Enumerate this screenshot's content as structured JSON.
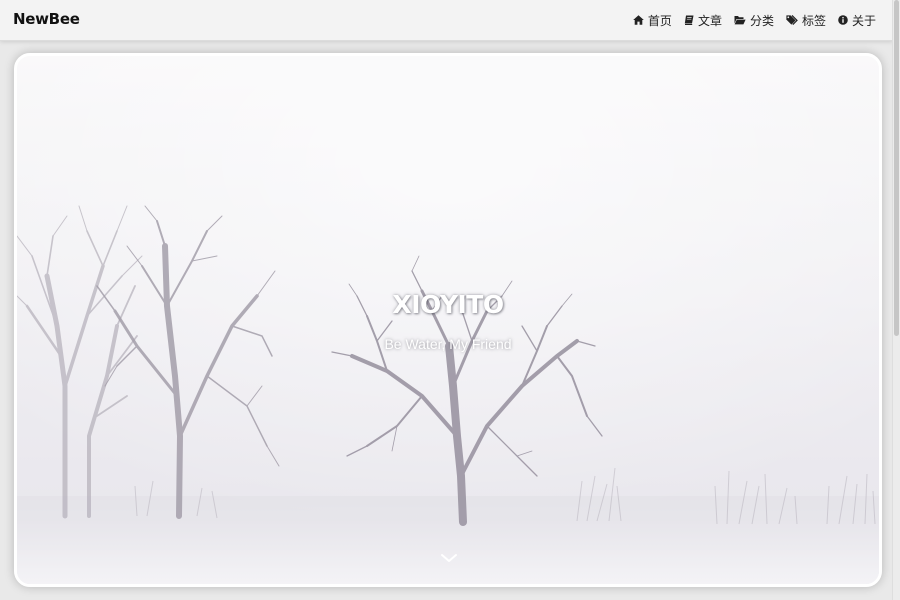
{
  "header": {
    "brand": "NewBee",
    "nav": [
      {
        "icon": "home-icon",
        "label": "首页"
      },
      {
        "icon": "book-icon",
        "label": "文章"
      },
      {
        "icon": "folder-open-icon",
        "label": "分类"
      },
      {
        "icon": "tags-icon",
        "label": "标签"
      },
      {
        "icon": "info-circle-icon",
        "label": "关于"
      }
    ]
  },
  "hero": {
    "title": "XIOYITO",
    "subtitle": "Be Water, My Friend",
    "scroll_icon": "chevron-down-icon"
  }
}
